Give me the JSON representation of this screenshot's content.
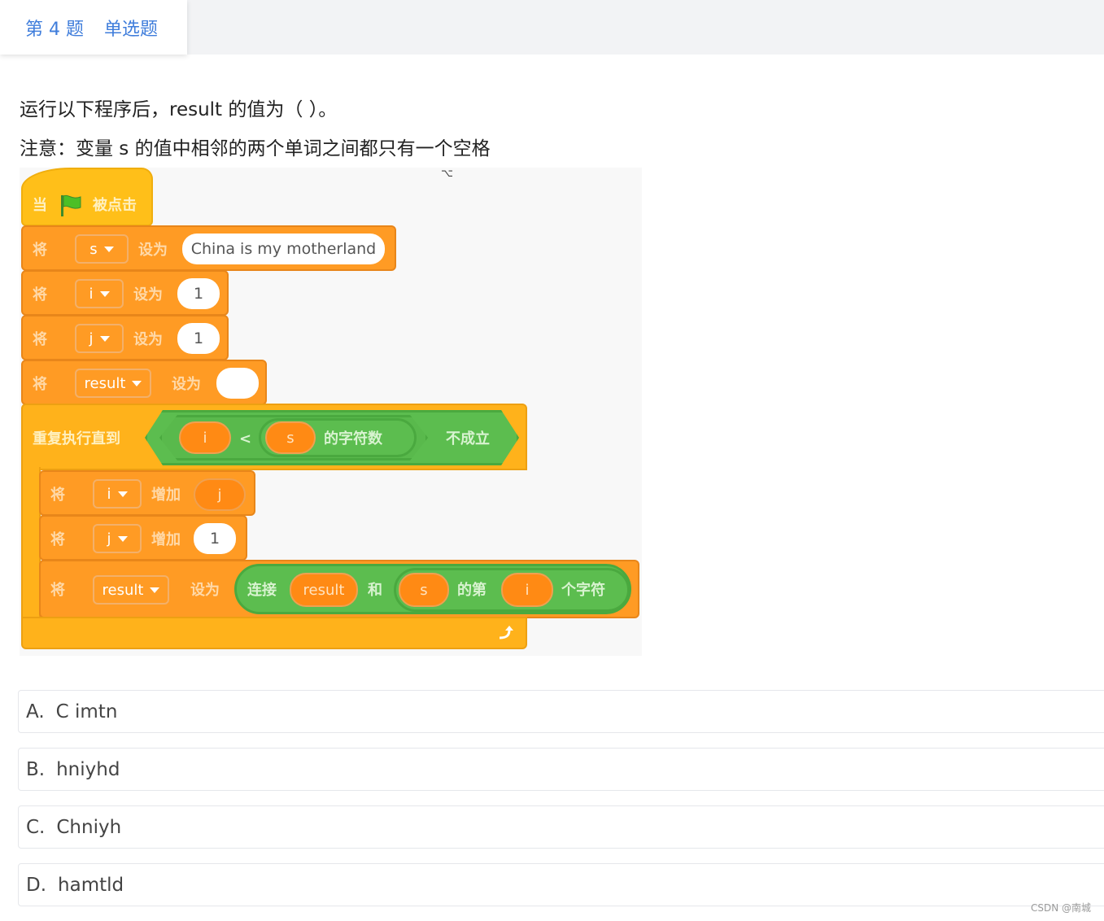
{
  "header": {
    "question_number": "第 4 题",
    "question_type": "单选题"
  },
  "question": {
    "line1": "运行以下程序后，result 的值为（  ）。",
    "line2": "注意：变量 s 的值中相邻的两个单词之间都只有一个空格"
  },
  "program": {
    "hat": {
      "when": "当",
      "clicked": "被点击",
      "icon": "green-flag-icon"
    },
    "set_word": "将",
    "set_to": "设为",
    "change_by": "增加",
    "statements": [
      {
        "var": "s",
        "value": "China is my motherland"
      },
      {
        "var": "i",
        "value": "1"
      },
      {
        "var": "j",
        "value": "1"
      },
      {
        "var": "result",
        "value": ""
      }
    ],
    "repeat": {
      "label": "重复执行直到",
      "left": "i",
      "op": "<",
      "var": "s",
      "length_of": "的字符数",
      "not": "不成立"
    },
    "loop_body": {
      "change_i": {
        "var": "i",
        "by": "j"
      },
      "change_j": {
        "var": "j",
        "by": "1"
      },
      "set_result": {
        "var": "result",
        "join": "连接",
        "arg1": "result",
        "and": "和",
        "str": "s",
        "letter_of": "的第",
        "index": "i",
        "char": "个字符"
      }
    },
    "loop_icon": "loop-arrow-icon"
  },
  "options": [
    {
      "label": "A.",
      "text": "C imtn"
    },
    {
      "label": "B.",
      "text": "hniyhd"
    },
    {
      "label": "C.",
      "text": "Chniyh"
    },
    {
      "label": "D.",
      "text": "hamtld"
    }
  ],
  "watermark": "CSDN @南城"
}
